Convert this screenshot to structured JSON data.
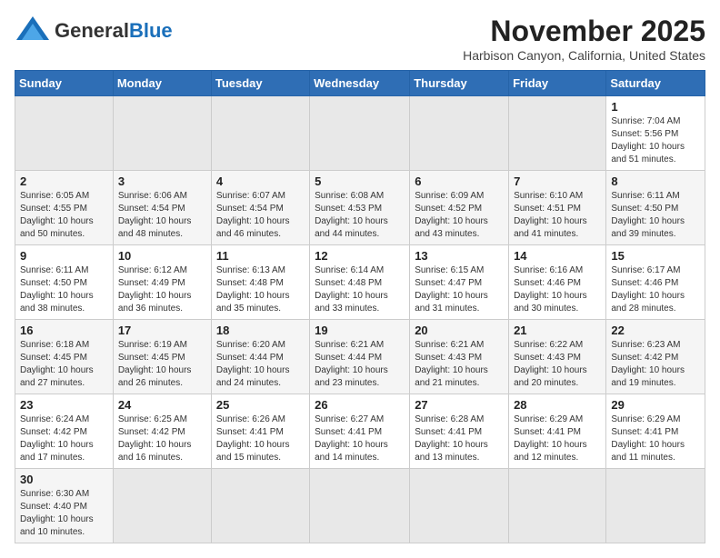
{
  "header": {
    "logo_general": "General",
    "logo_blue": "Blue",
    "month_year": "November 2025",
    "location": "Harbison Canyon, California, United States"
  },
  "weekdays": [
    "Sunday",
    "Monday",
    "Tuesday",
    "Wednesday",
    "Thursday",
    "Friday",
    "Saturday"
  ],
  "weeks": [
    [
      {
        "day": "",
        "info": ""
      },
      {
        "day": "",
        "info": ""
      },
      {
        "day": "",
        "info": ""
      },
      {
        "day": "",
        "info": ""
      },
      {
        "day": "",
        "info": ""
      },
      {
        "day": "",
        "info": ""
      },
      {
        "day": "1",
        "info": "Sunrise: 7:04 AM\nSunset: 5:56 PM\nDaylight: 10 hours and 51 minutes."
      }
    ],
    [
      {
        "day": "2",
        "info": "Sunrise: 6:05 AM\nSunset: 4:55 PM\nDaylight: 10 hours and 50 minutes."
      },
      {
        "day": "3",
        "info": "Sunrise: 6:06 AM\nSunset: 4:54 PM\nDaylight: 10 hours and 48 minutes."
      },
      {
        "day": "4",
        "info": "Sunrise: 6:07 AM\nSunset: 4:54 PM\nDaylight: 10 hours and 46 minutes."
      },
      {
        "day": "5",
        "info": "Sunrise: 6:08 AM\nSunset: 4:53 PM\nDaylight: 10 hours and 44 minutes."
      },
      {
        "day": "6",
        "info": "Sunrise: 6:09 AM\nSunset: 4:52 PM\nDaylight: 10 hours and 43 minutes."
      },
      {
        "day": "7",
        "info": "Sunrise: 6:10 AM\nSunset: 4:51 PM\nDaylight: 10 hours and 41 minutes."
      },
      {
        "day": "8",
        "info": "Sunrise: 6:11 AM\nSunset: 4:50 PM\nDaylight: 10 hours and 39 minutes."
      }
    ],
    [
      {
        "day": "9",
        "info": "Sunrise: 6:11 AM\nSunset: 4:50 PM\nDaylight: 10 hours and 38 minutes."
      },
      {
        "day": "10",
        "info": "Sunrise: 6:12 AM\nSunset: 4:49 PM\nDaylight: 10 hours and 36 minutes."
      },
      {
        "day": "11",
        "info": "Sunrise: 6:13 AM\nSunset: 4:48 PM\nDaylight: 10 hours and 35 minutes."
      },
      {
        "day": "12",
        "info": "Sunrise: 6:14 AM\nSunset: 4:48 PM\nDaylight: 10 hours and 33 minutes."
      },
      {
        "day": "13",
        "info": "Sunrise: 6:15 AM\nSunset: 4:47 PM\nDaylight: 10 hours and 31 minutes."
      },
      {
        "day": "14",
        "info": "Sunrise: 6:16 AM\nSunset: 4:46 PM\nDaylight: 10 hours and 30 minutes."
      },
      {
        "day": "15",
        "info": "Sunrise: 6:17 AM\nSunset: 4:46 PM\nDaylight: 10 hours and 28 minutes."
      }
    ],
    [
      {
        "day": "16",
        "info": "Sunrise: 6:18 AM\nSunset: 4:45 PM\nDaylight: 10 hours and 27 minutes."
      },
      {
        "day": "17",
        "info": "Sunrise: 6:19 AM\nSunset: 4:45 PM\nDaylight: 10 hours and 26 minutes."
      },
      {
        "day": "18",
        "info": "Sunrise: 6:20 AM\nSunset: 4:44 PM\nDaylight: 10 hours and 24 minutes."
      },
      {
        "day": "19",
        "info": "Sunrise: 6:21 AM\nSunset: 4:44 PM\nDaylight: 10 hours and 23 minutes."
      },
      {
        "day": "20",
        "info": "Sunrise: 6:21 AM\nSunset: 4:43 PM\nDaylight: 10 hours and 21 minutes."
      },
      {
        "day": "21",
        "info": "Sunrise: 6:22 AM\nSunset: 4:43 PM\nDaylight: 10 hours and 20 minutes."
      },
      {
        "day": "22",
        "info": "Sunrise: 6:23 AM\nSunset: 4:42 PM\nDaylight: 10 hours and 19 minutes."
      }
    ],
    [
      {
        "day": "23",
        "info": "Sunrise: 6:24 AM\nSunset: 4:42 PM\nDaylight: 10 hours and 17 minutes."
      },
      {
        "day": "24",
        "info": "Sunrise: 6:25 AM\nSunset: 4:42 PM\nDaylight: 10 hours and 16 minutes."
      },
      {
        "day": "25",
        "info": "Sunrise: 6:26 AM\nSunset: 4:41 PM\nDaylight: 10 hours and 15 minutes."
      },
      {
        "day": "26",
        "info": "Sunrise: 6:27 AM\nSunset: 4:41 PM\nDaylight: 10 hours and 14 minutes."
      },
      {
        "day": "27",
        "info": "Sunrise: 6:28 AM\nSunset: 4:41 PM\nDaylight: 10 hours and 13 minutes."
      },
      {
        "day": "28",
        "info": "Sunrise: 6:29 AM\nSunset: 4:41 PM\nDaylight: 10 hours and 12 minutes."
      },
      {
        "day": "29",
        "info": "Sunrise: 6:29 AM\nSunset: 4:41 PM\nDaylight: 10 hours and 11 minutes."
      }
    ],
    [
      {
        "day": "30",
        "info": "Sunrise: 6:30 AM\nSunset: 4:40 PM\nDaylight: 10 hours and 10 minutes."
      },
      {
        "day": "",
        "info": ""
      },
      {
        "day": "",
        "info": ""
      },
      {
        "day": "",
        "info": ""
      },
      {
        "day": "",
        "info": ""
      },
      {
        "day": "",
        "info": ""
      },
      {
        "day": "",
        "info": ""
      }
    ]
  ]
}
